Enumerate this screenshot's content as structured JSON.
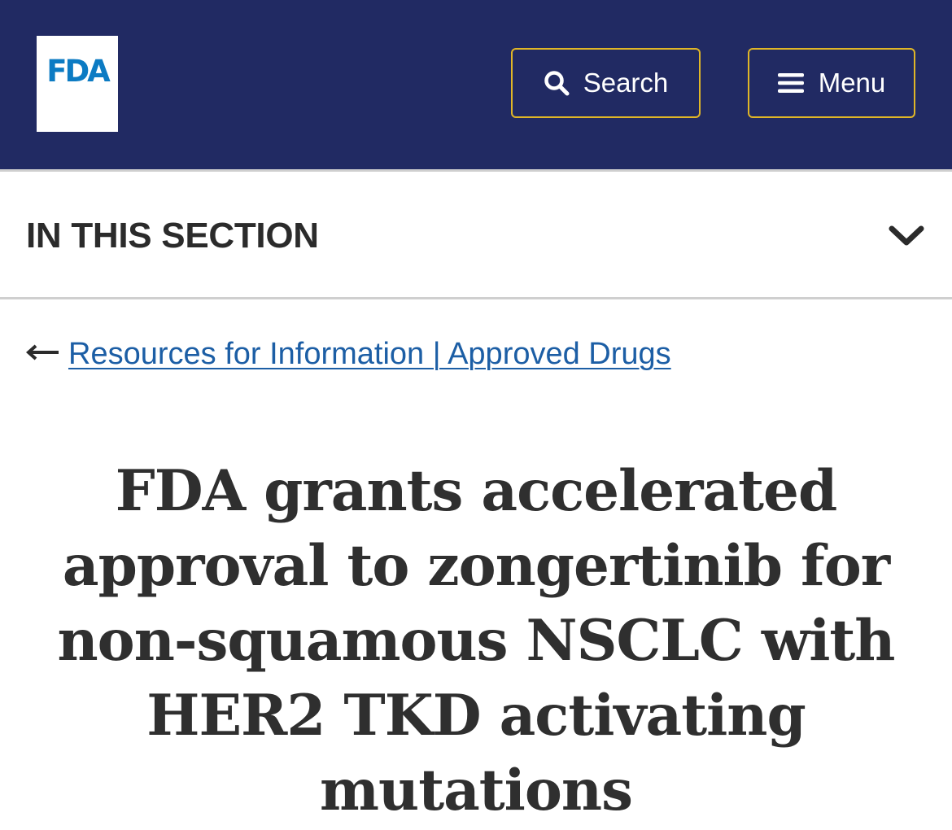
{
  "header": {
    "logo_text": "FDA",
    "search_label": "Search",
    "menu_label": "Menu",
    "colors": {
      "background": "#212a63",
      "button_border": "#e0b627",
      "logo_text": "#0c7bc3"
    }
  },
  "section_nav": {
    "title": "IN THIS SECTION",
    "toggle_icon": "chevron-down-icon"
  },
  "breadcrumb": {
    "back_icon": "left-arrow-icon",
    "link_text": "Resources for Information | Approved Drugs",
    "link_color": "#1c5ea5"
  },
  "article": {
    "title": "FDA grants accelerated approval to zongertinib for non-squamous NSCLC with HER2 TKD activating mutations"
  }
}
